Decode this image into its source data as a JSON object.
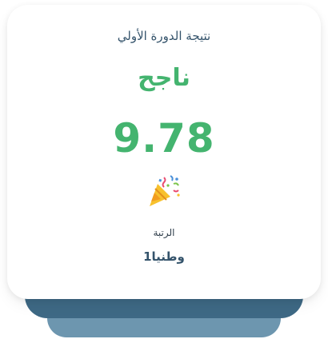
{
  "result": {
    "title": "نتيجة الدورة الأولي",
    "status": "ناجح",
    "score": "9.78",
    "celebration_icon": "party-popper-icon",
    "rank_label": "الرتبة",
    "rank_value": "وطنيا1"
  },
  "colors": {
    "accent_green": "#44b46f",
    "text_navy": "#34536b",
    "stack_dark": "#3e6985",
    "stack_light": "#6d96af"
  }
}
